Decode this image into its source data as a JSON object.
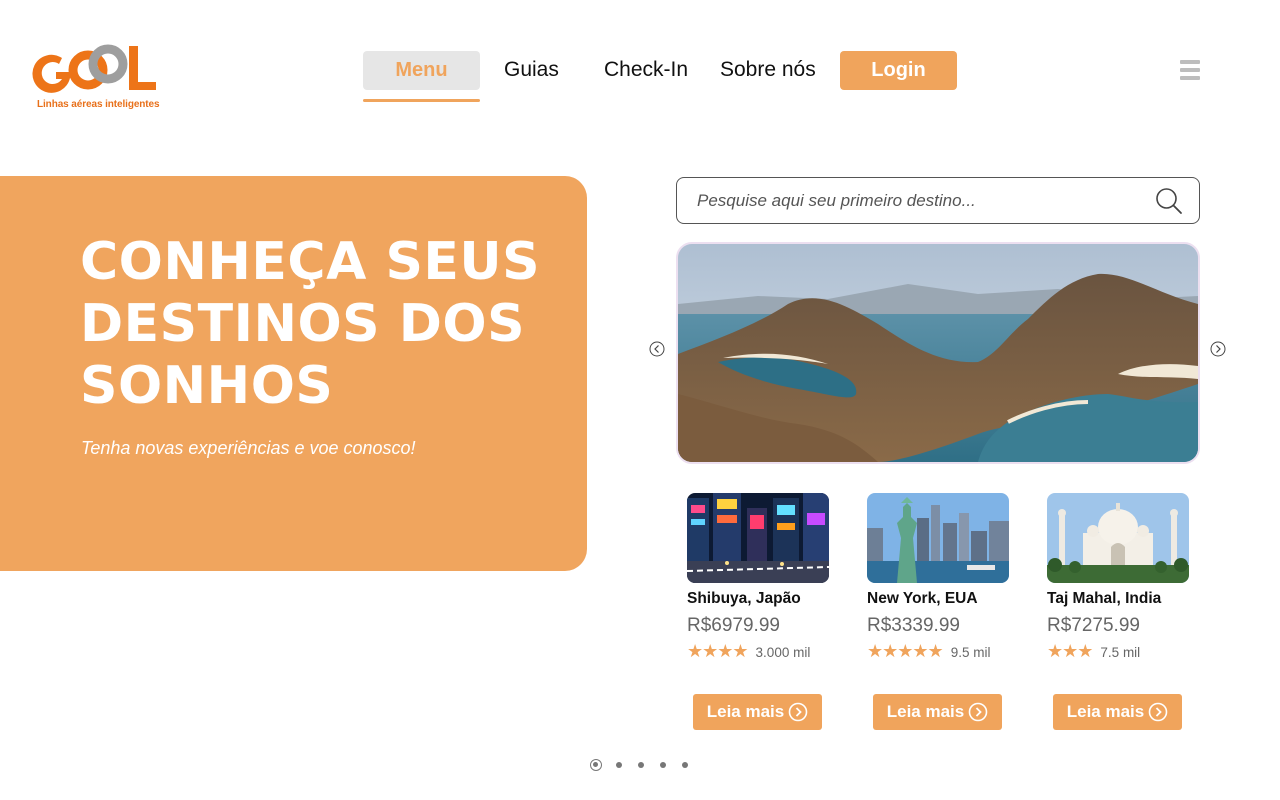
{
  "brand": {
    "logo_text": "GOOL",
    "tagline": "Linhas aéreas inteligentes",
    "accent_color": "#f0a45c",
    "logo_color": "#ed7418"
  },
  "nav": {
    "items": [
      {
        "label": "Menu",
        "active": true
      },
      {
        "label": "Guias"
      },
      {
        "label": "Check-In"
      },
      {
        "label": "Sobre nós"
      }
    ],
    "login_label": "Login",
    "menu_icon": "hamburger-icon"
  },
  "hero": {
    "title": "CONHEÇA SEUS DESTINOS DOS SONHOS",
    "subtitle": "Tenha novas experiências e voe conosco!"
  },
  "search": {
    "placeholder": "Pesquise aqui seu primeiro destino...",
    "icon": "search-icon"
  },
  "carousel": {
    "prev_icon": "chevron-left-circle-icon",
    "next_icon": "chevron-right-circle-icon"
  },
  "cards": [
    {
      "name": "Shibuya, Japão",
      "price": "R$6979.99",
      "stars": "★★★★",
      "reviews": "3.000 mil",
      "button": "Leia mais"
    },
    {
      "name": "New York, EUA",
      "price": "R$3339.99",
      "stars": "★★★★★",
      "reviews": "9.5 mil",
      "button": "Leia mais"
    },
    {
      "name": "Taj Mahal, India",
      "price": "R$7275.99",
      "stars": "★★★",
      "reviews": "7.5 mil",
      "button": "Leia mais"
    }
  ],
  "pagination": {
    "pages": 5,
    "active_page": 1
  }
}
